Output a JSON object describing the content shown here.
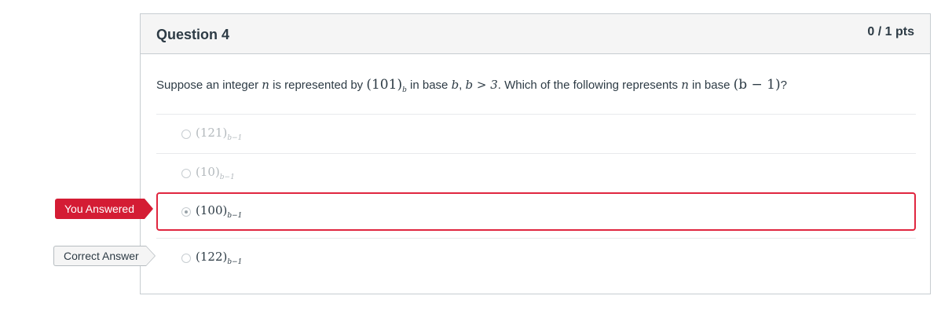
{
  "question": {
    "title": "Question 4",
    "points": "0 / 1 pts",
    "text_parts": {
      "p1": "Suppose an integer ",
      "n1": "n",
      "p2": " is represented by ",
      "num": "(101)",
      "sub_b": "b",
      "p3": " in base ",
      "b1": "b",
      "p4": ", ",
      "ineq": "b > 3",
      "p5": ". Which of the following represents ",
      "n2": "n",
      "p6": " in base ",
      "base": "(b − 1)",
      "p7": "?"
    }
  },
  "answers": [
    {
      "value": "(121)",
      "sub": "b−1",
      "state": "dim"
    },
    {
      "value": "(10)",
      "sub": "b−1",
      "state": "dim"
    },
    {
      "value": "(100)",
      "sub": "b−1",
      "state": "selected"
    },
    {
      "value": "(122)",
      "sub": "b−1",
      "state": "correct"
    }
  ],
  "flags": {
    "you_answered": "You Answered",
    "correct_answer": "Correct Answer"
  },
  "colors": {
    "selected_border": "#e0263f",
    "you_answered_bg": "#d41c34",
    "header_bg": "#f5f5f5"
  }
}
